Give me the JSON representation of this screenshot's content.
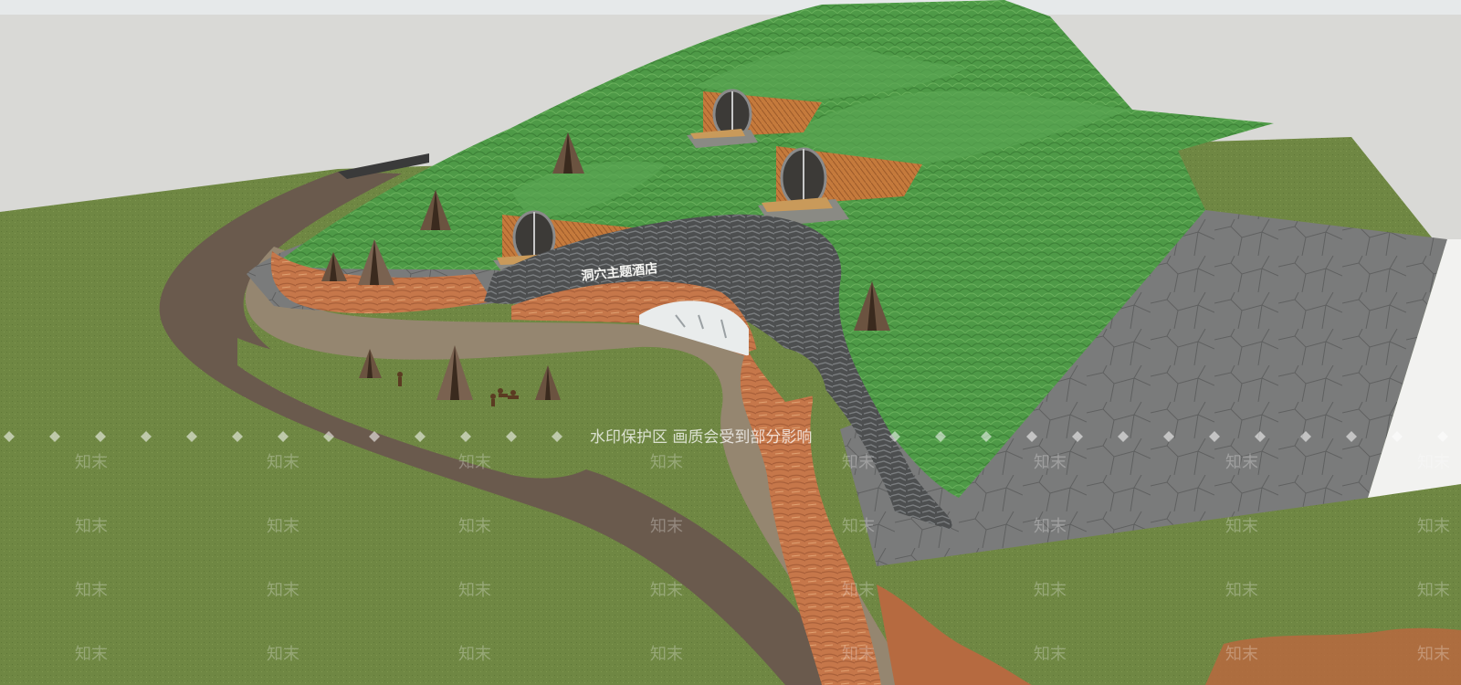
{
  "viewport": {
    "background": "#d9d9d6",
    "top_bar_color": "#e6e9ea"
  },
  "model": {
    "sign_text": "洞穴主题酒店",
    "colors": {
      "grass_ground": "#6f8743",
      "green_roof": "#4e9a47",
      "green_roof_dark": "#3f8a3c",
      "path_brown": "#6a5a4d",
      "path_tan": "#958670",
      "paving_grey": "#7a7b7b",
      "rock_dark": "#4d4f50",
      "cliff_orange": "#c6774a",
      "wood_facade": "#c57a3c",
      "glass": "#e9ecec"
    },
    "icons": [
      "teepee-icon",
      "villager-figure-icon",
      "round-window-icon"
    ]
  },
  "watermark": {
    "banner_text": "水印保护区  画质会受到部分影响",
    "brand_text": "知末"
  }
}
